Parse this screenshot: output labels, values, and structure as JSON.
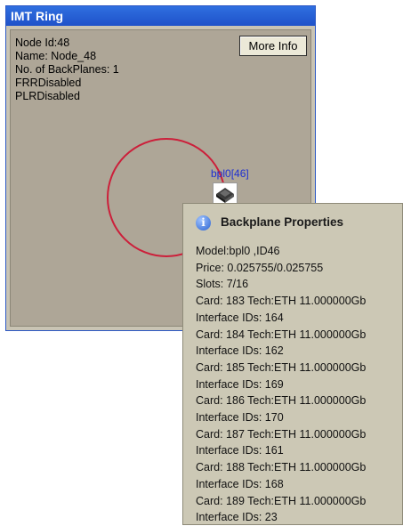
{
  "window": {
    "title": "IMT Ring",
    "node_info": [
      "Node Id:48",
      "Name: Node_48",
      "No. of BackPlanes: 1",
      "FRRDisabled",
      "PLRDisabled"
    ],
    "more_info_label": "More Info",
    "ring_color": "#cc1f3a",
    "backplane_label": "bpl0[46]"
  },
  "tooltip": {
    "title": "Backplane Properties",
    "icon": "info-icon",
    "lines": [
      "Model:bpl0 ,ID46",
      "Price: 0.025755/0.025755",
      "Slots: 7/16",
      "Card: 183  Tech:ETH 11.000000Gb",
      "Interface IDs: 164",
      "Card: 184  Tech:ETH 11.000000Gb",
      "Interface IDs: 162",
      "Card: 185  Tech:ETH 11.000000Gb",
      "Interface IDs: 169",
      "Card: 186  Tech:ETH 11.000000Gb",
      "Interface IDs: 170",
      "Card: 187  Tech:ETH 11.000000Gb",
      "Interface IDs: 161",
      "Card: 188  Tech:ETH 11.000000Gb",
      "Interface IDs: 168",
      "Card: 189  Tech:ETH 11.000000Gb",
      "Interface IDs: 23"
    ]
  }
}
